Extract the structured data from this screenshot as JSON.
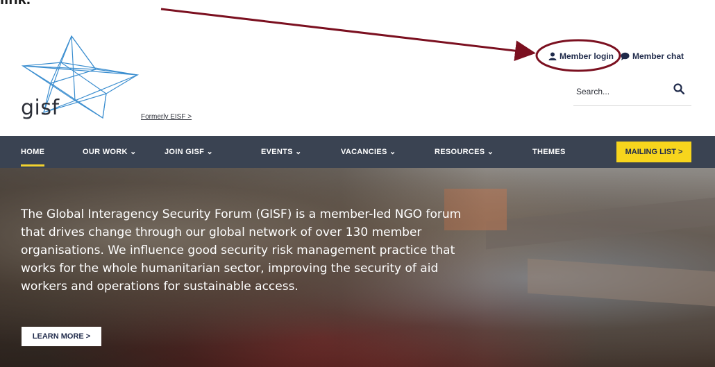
{
  "caption": "link.",
  "logo": {
    "text": "gisf",
    "formerly": "Formerly EISF >"
  },
  "member": {
    "login_label": "Member login",
    "chat_label": "Member chat"
  },
  "search": {
    "placeholder": "Search..."
  },
  "nav": {
    "items": [
      {
        "label": "HOME",
        "active": true
      },
      {
        "label": "OUR WORK ⌄"
      },
      {
        "label": "JOIN GISF ⌄"
      },
      {
        "label": "EVENTS ⌄"
      },
      {
        "label": "VACANCIES ⌄"
      },
      {
        "label": "RESOURCES ⌄"
      },
      {
        "label": "THEMES"
      }
    ],
    "mailing_list": "MAILING LIST >"
  },
  "hero": {
    "text": "The Global Interagency Security Forum (GISF) is a member-led NGO forum that drives change through our global network of over 130 member organisations. We influence good security risk management practice that works for the whole humanitarian sector, improving the security of aid workers and operations for sustainable access.",
    "learn_more": "LEARN MORE >"
  },
  "colors": {
    "nav_bg": "#3a4352",
    "accent_yellow": "#f7d51d",
    "annotation": "#7b1020",
    "brand_navy": "#1f2a4a"
  }
}
